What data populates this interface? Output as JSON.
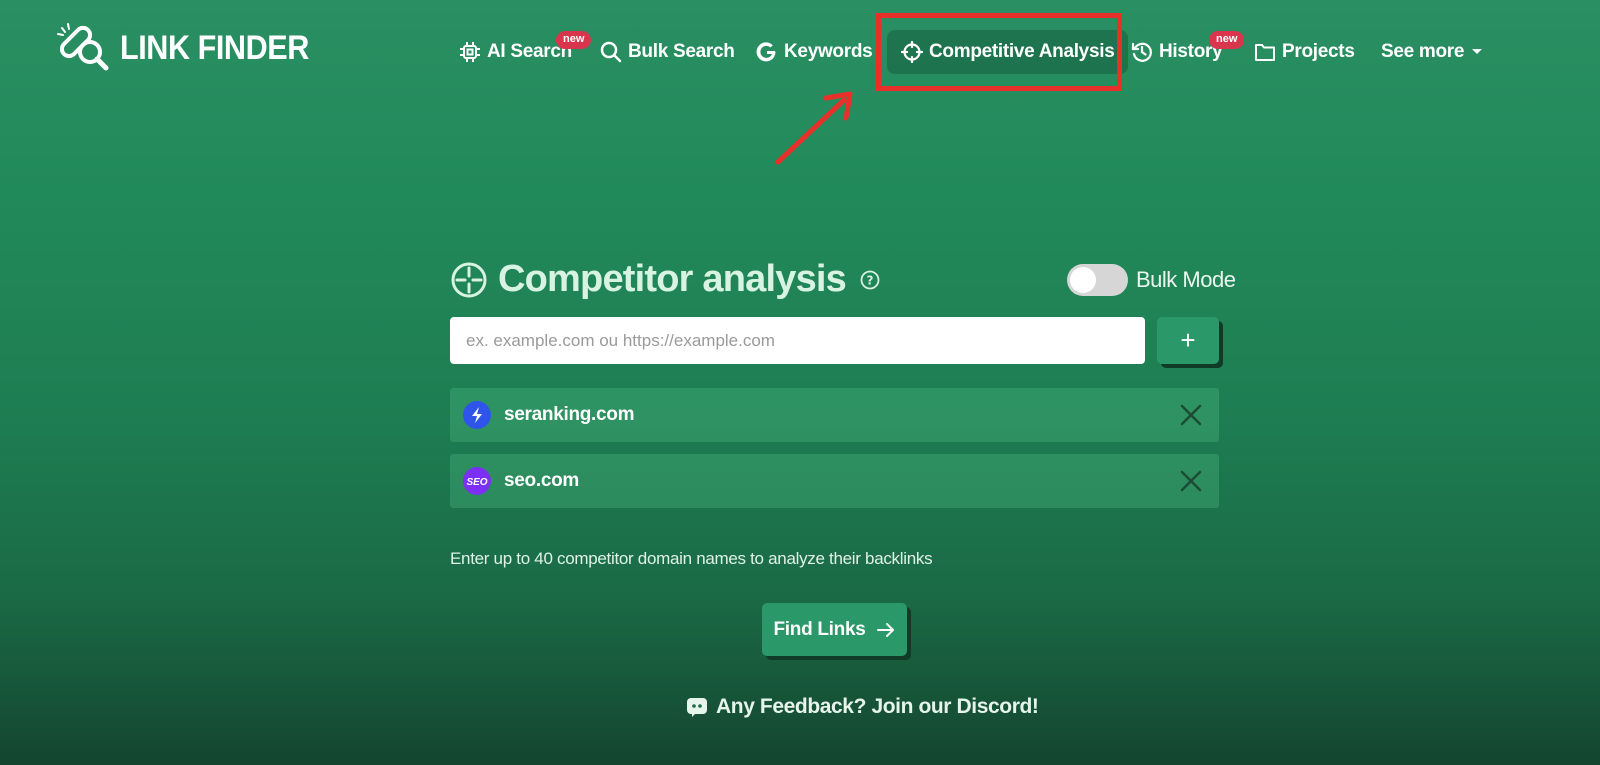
{
  "brand": {
    "name": "LINK FINDER",
    "logo_icon": "link-search-icon"
  },
  "nav": {
    "items": [
      {
        "label": "AI Search",
        "icon": "chip-icon",
        "badge": "new"
      },
      {
        "label": "Bulk Search",
        "icon": "search-icon"
      },
      {
        "label": "Keywords",
        "icon": "google-g-icon"
      },
      {
        "label": "Competitive Analysis",
        "icon": "crosshair-icon",
        "active": true
      },
      {
        "label": "History",
        "icon": "history-icon",
        "badge": "new"
      },
      {
        "label": "Projects",
        "icon": "folder-icon"
      },
      {
        "label": "See more",
        "icon": "caret-down-icon"
      }
    ]
  },
  "panel": {
    "title": "Competitor analysis",
    "title_icon": "crosshair-icon",
    "bulk_mode_label": "Bulk Mode",
    "bulk_mode_enabled": false,
    "input_placeholder": "ex. example.com ou https://example.com",
    "input_value": "",
    "add_button_label": "+",
    "domains": [
      {
        "name": "seranking.com",
        "favicon": "seranking-bolt-icon",
        "favicon_color": "#2f54eb"
      },
      {
        "name": "seo.com",
        "favicon": "seo-logo-icon",
        "favicon_color": "#7b2ff7",
        "favicon_text": "SEO"
      }
    ],
    "helper_text": "Enter up to 40 competitor domain names to analyze their backlinks",
    "find_button_label": "Find Links"
  },
  "feedback": {
    "label": "Any Feedback? Join our Discord!",
    "icon": "discord-icon"
  },
  "colors": {
    "accent": "#2a9868",
    "annotation": "#e8302b",
    "badge": "#d9364e"
  }
}
